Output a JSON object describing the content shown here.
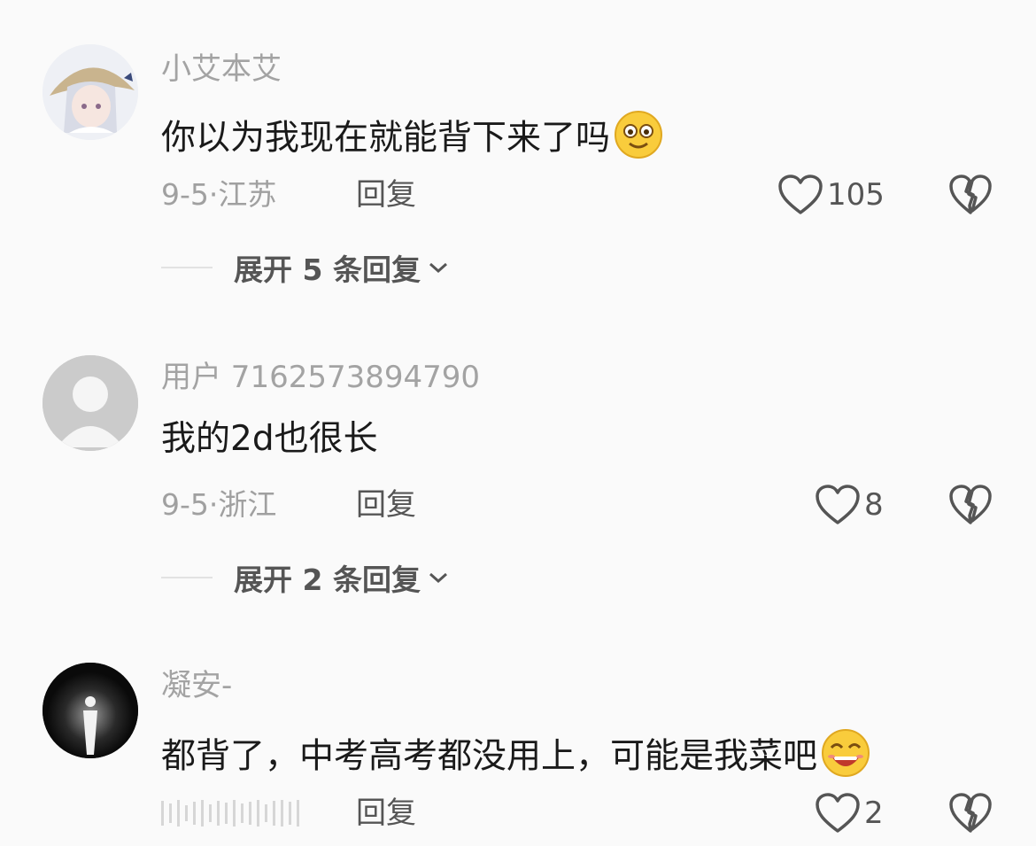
{
  "comments": [
    {
      "username": "小艾本艾",
      "text": "你以为我现在就能背下来了吗",
      "emoji": "smile-emoji",
      "date": "9-5",
      "location": "江苏",
      "reply_label": "回复",
      "likes": "105",
      "expand_label": "展开 5 条回复",
      "avatar": "anime-girl-avatar"
    },
    {
      "username": "用户 7162573894790",
      "text": "我的2d也很长",
      "date": "9-5",
      "location": "浙江",
      "reply_label": "回复",
      "likes": "8",
      "expand_label": "展开 2 条回复",
      "avatar": "default-user-avatar"
    },
    {
      "username": "凝安-",
      "text": "都背了，中考高考都没用上，可能是我菜吧",
      "emoji": "grin-emoji",
      "reply_label": "回复",
      "likes": "2",
      "avatar": "dark-figure-avatar"
    }
  ],
  "meta_separator": "·",
  "colors": {
    "background": "#fafafa",
    "username": "#a3a3a3",
    "text": "#1a1a1a",
    "secondary": "#555555"
  }
}
